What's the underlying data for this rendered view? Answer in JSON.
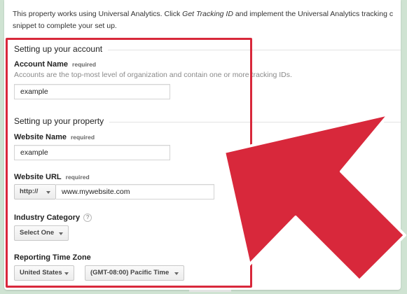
{
  "intro": {
    "line1_prefix": "This property works using Universal Analytics. Click ",
    "line1_link": "Get Tracking ID",
    "line1_suffix": " and implement the Universal Analytics tracking c",
    "line2": "snippet to complete your set up."
  },
  "account_section": {
    "heading": "Setting up your account",
    "account_name": {
      "label": "Account Name",
      "required": "required",
      "description": "Accounts are the top-most level of organization and contain one or more tracking IDs.",
      "value": "example"
    }
  },
  "property_section": {
    "heading": "Setting up your property",
    "website_name": {
      "label": "Website Name",
      "required": "required",
      "value": "example"
    },
    "website_url": {
      "label": "Website URL",
      "required": "required",
      "protocol": "http://",
      "value": "www.mywebsite.com"
    },
    "industry_category": {
      "label": "Industry Category",
      "help": "?",
      "selected": "Select One"
    },
    "reporting_time_zone": {
      "label": "Reporting Time Zone",
      "country": "United States",
      "zone": "(GMT-08:00) Pacific Time"
    }
  },
  "colors": {
    "highlight": "#d8283b",
    "arrow_fill": "#d8283b",
    "arrow_outline": "#ffffff",
    "background": "#cfe3d2"
  }
}
